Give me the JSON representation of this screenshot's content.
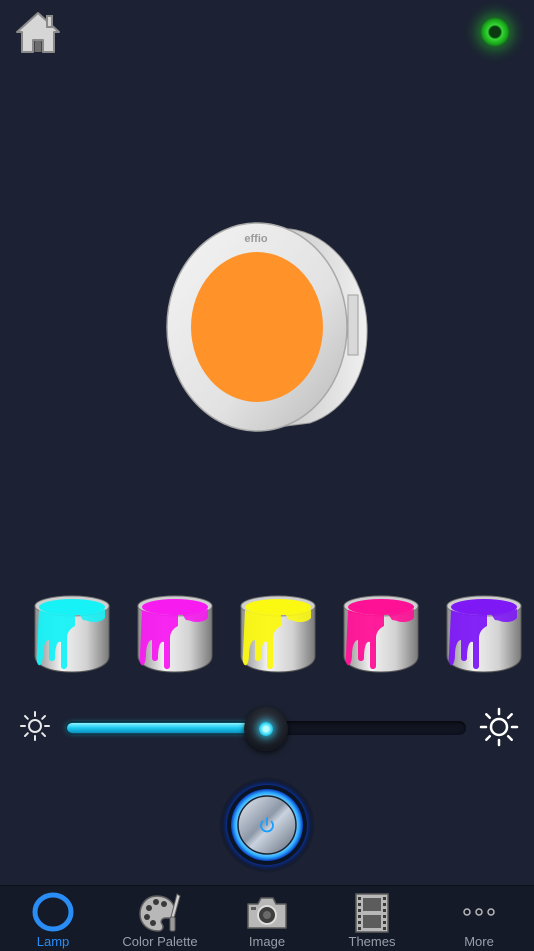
{
  "header": {
    "home_icon": "home-icon",
    "status_indicator_color": "#22cc22"
  },
  "lamp": {
    "brand": "effio",
    "light_color": "#ff9229",
    "ring_color": "#e6e6e6"
  },
  "color_presets": [
    {
      "name": "cyan",
      "color": "#17f2f6"
    },
    {
      "name": "magenta",
      "color": "#f71bf0"
    },
    {
      "name": "yellow",
      "color": "#fbf812"
    },
    {
      "name": "pink",
      "color": "#ff1196"
    },
    {
      "name": "violet",
      "color": "#7e18f5"
    }
  ],
  "brightness": {
    "value_percent": 50,
    "min_icon": "sun-small-icon",
    "max_icon": "sun-large-icon",
    "accent": "#1ac9ef"
  },
  "power": {
    "icon": "power-icon"
  },
  "tabs": [
    {
      "label": "Lamp",
      "icon": "lamp-ring-icon",
      "active": true
    },
    {
      "label": "Color Palette",
      "icon": "palette-icon",
      "active": false
    },
    {
      "label": "Image",
      "icon": "camera-icon",
      "active": false
    },
    {
      "label": "Themes",
      "icon": "film-icon",
      "active": false
    },
    {
      "label": "More",
      "icon": "more-dots-icon",
      "active": false
    }
  ],
  "active_tab_color": "#2a8cf5",
  "inactive_tab_color": "#9a9ea8"
}
